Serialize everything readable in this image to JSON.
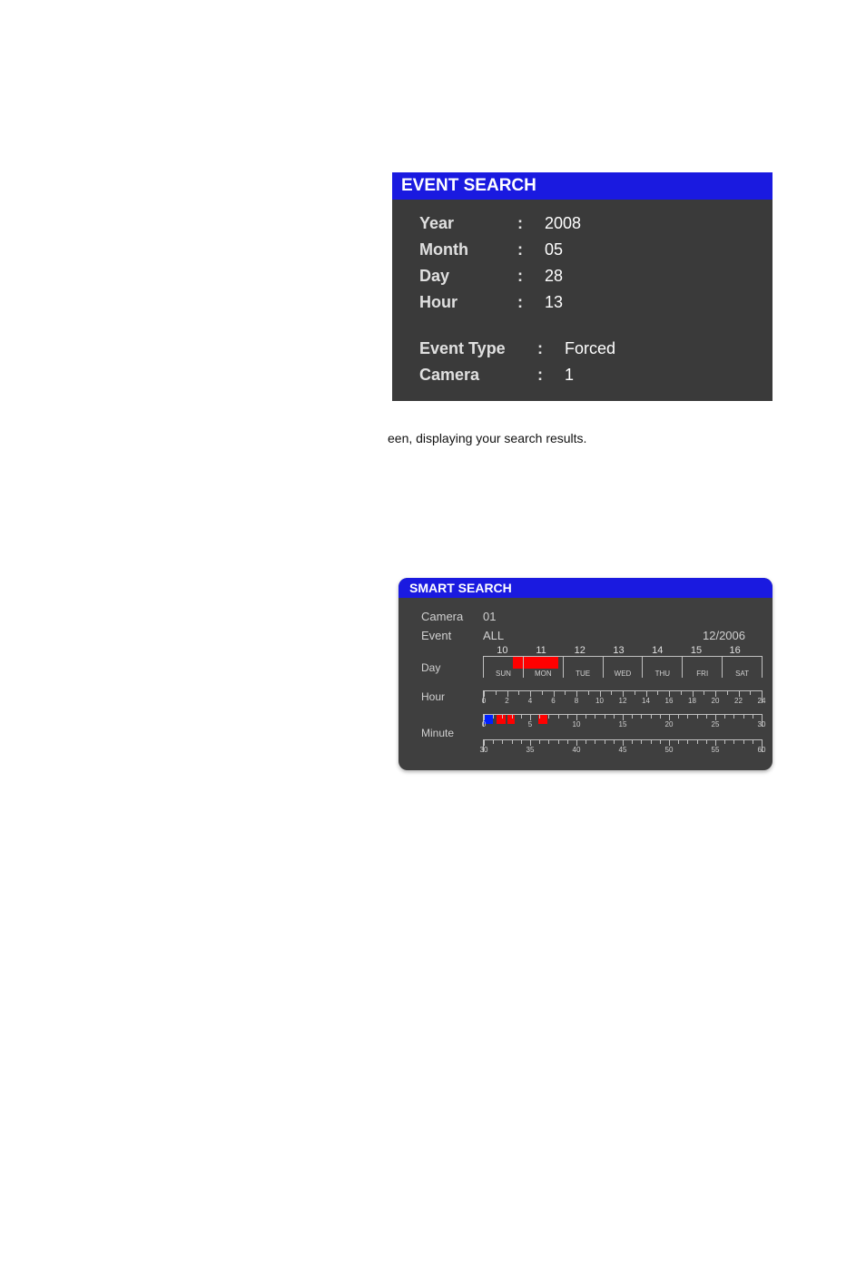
{
  "event_search": {
    "title": "EVENT SEARCH",
    "year_label": "Year",
    "year_value": "2008",
    "month_label": "Month",
    "month_value": "05",
    "day_label": "Day",
    "day_value": "28",
    "hour_label": "Hour",
    "hour_value": "13",
    "event_type_label": "Event Type",
    "event_type_value": "Forced",
    "camera_label": "Camera",
    "camera_value": "1",
    "colon": ":"
  },
  "caption": "een, displaying your search results.",
  "smart_search": {
    "title": "SMART SEARCH",
    "camera_label": "Camera",
    "camera_value": "01",
    "event_label": "Event",
    "event_value": "ALL",
    "date": "12/2006",
    "day_label": "Day",
    "hour_label": "Hour",
    "minute_label": "Minute",
    "day_numbers": [
      "10",
      "11",
      "12",
      "13",
      "14",
      "15",
      "16"
    ],
    "day_names": [
      "SUN",
      "MON",
      "TUE",
      "WED",
      "THU",
      "FRI",
      "SAT"
    ],
    "hour_ticks": [
      "0",
      "2",
      "4",
      "6",
      "8",
      "10",
      "12",
      "14",
      "16",
      "18",
      "20",
      "22",
      "24"
    ],
    "minute_ticks1": [
      "0",
      "5",
      "10",
      "15",
      "20",
      "25",
      "30"
    ],
    "minute_ticks2": [
      "30",
      "35",
      "40",
      "45",
      "50",
      "55",
      "60"
    ]
  }
}
